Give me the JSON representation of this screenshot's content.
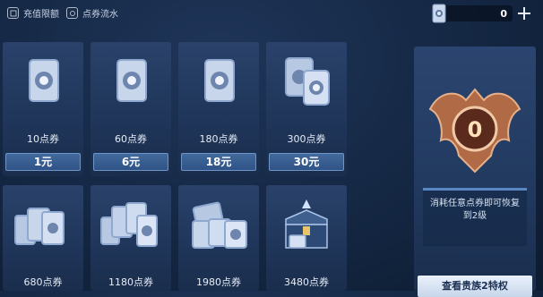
{
  "topbar": {
    "recharge_limit_label": "充值限额",
    "coupon_flow_label": "点券流水",
    "balance": "0"
  },
  "cards": [
    {
      "label": "10点券",
      "price": "1元",
      "art": "single-card-icon"
    },
    {
      "label": "60点券",
      "price": "6元",
      "art": "single-card-icon"
    },
    {
      "label": "180点券",
      "price": "18元",
      "art": "single-card-icon"
    },
    {
      "label": "300点券",
      "price": "30元",
      "art": "double-card-icon"
    },
    {
      "label": "680点券",
      "art": "card-fan-icon"
    },
    {
      "label": "1180点券",
      "art": "card-fan-icon"
    },
    {
      "label": "1980点券",
      "art": "card-stack-icon"
    },
    {
      "label": "3480点券",
      "art": "treasure-chest-icon"
    }
  ],
  "noble": {
    "badge_level": "0",
    "description": "消耗任意点券即可恢复到2级",
    "button_label": "查看贵族2特权"
  },
  "colors": {
    "background": "#142743",
    "card_bg": "#2a426a",
    "price_button": "#3a6194",
    "badge_bronze": "#b06a45",
    "noble_button": "#dfe8f5"
  }
}
